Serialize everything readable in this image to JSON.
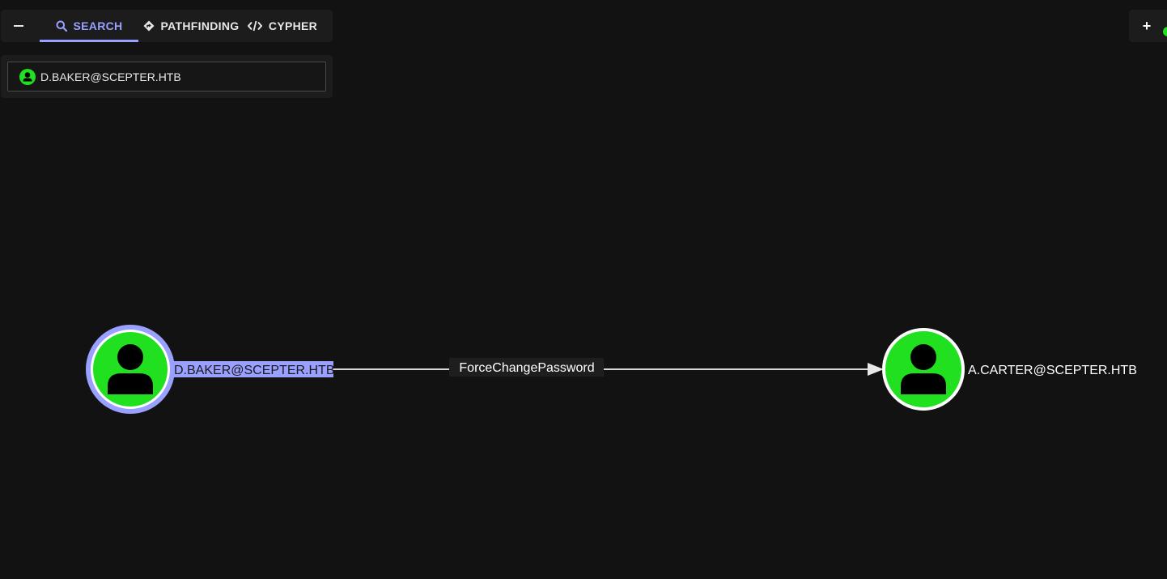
{
  "toolbar": {
    "tabs": [
      {
        "label": "SEARCH",
        "icon": "search-icon",
        "active": true
      },
      {
        "label": "PATHFINDING",
        "icon": "pathfinding-icon",
        "active": false
      },
      {
        "label": "CYPHER",
        "icon": "code-icon",
        "active": false
      }
    ]
  },
  "search": {
    "value": "D.BAKER@SCEPTER.HTB",
    "node_icon": "user-icon"
  },
  "graph": {
    "nodes": [
      {
        "label": "D.BAKER@SCEPTER.HTB",
        "type": "user",
        "selected": true
      },
      {
        "label": "A.CARTER@SCEPTER.HTB",
        "type": "user",
        "selected": false
      }
    ],
    "edges": [
      {
        "label": "ForceChangePassword",
        "from": "D.BAKER@SCEPTER.HTB",
        "to": "A.CARTER@SCEPTER.HTB"
      }
    ]
  },
  "colors": {
    "background": "#121212",
    "accent": "#9aa0ff",
    "user_node": "#20e020",
    "panel": "#1c1c1c"
  },
  "right_toolbar": {
    "add_label": "+"
  }
}
